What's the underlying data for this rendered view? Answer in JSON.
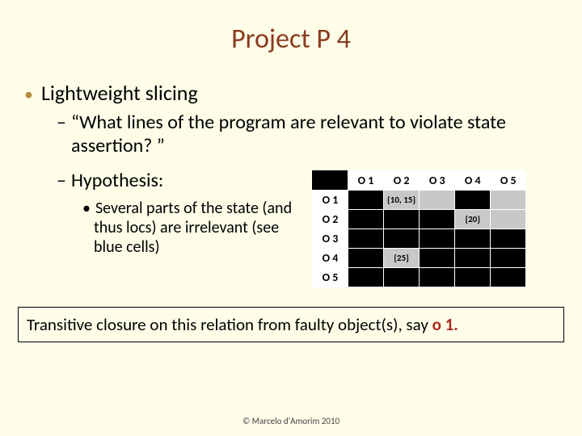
{
  "title": "Project P 4",
  "bullet1": "Lightweight slicing",
  "bullet2": "“What lines of the program are relevant to violate state assertion? ”",
  "bullet3_head": "Hypothesis:",
  "bullet3_sub": "Several parts of the state (and thus locs) are irrelevant (see blue cells)",
  "table": {
    "cols": [
      "O 1",
      "O 2",
      "O 3",
      "O 4",
      "O 5"
    ],
    "rows": [
      "O 1",
      "O 2",
      "O 3",
      "O 4",
      "O 5"
    ],
    "cell_o1_o2": "{10, 15}",
    "cell_o2_o4": "{20}",
    "cell_o4_o2": "{25}"
  },
  "footer_text": "Transitive closure on this relation from faulty object(s), say ",
  "footer_obj": "o 1.",
  "copyright": "© Marcelo d'Amorim 2010"
}
